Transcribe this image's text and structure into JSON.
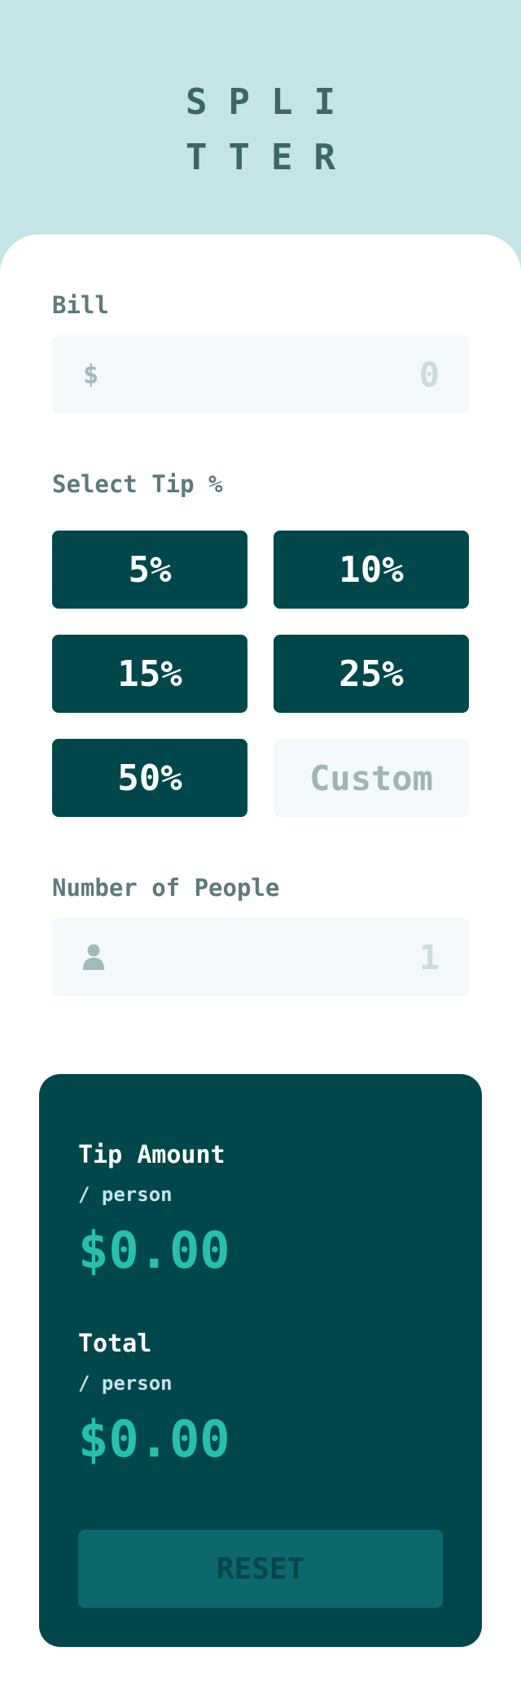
{
  "app": {
    "logo_line1": "SPLI",
    "logo_line2": "TTER"
  },
  "bill": {
    "label": "Bill",
    "currency_icon": "$",
    "placeholder": "0",
    "value": ""
  },
  "tip": {
    "label": "Select Tip %",
    "options": [
      "5%",
      "10%",
      "15%",
      "25%",
      "50%"
    ],
    "custom_placeholder": "Custom"
  },
  "people": {
    "label": "Number of People",
    "icon": "person-icon",
    "placeholder": "1",
    "value": ""
  },
  "results": {
    "tip_title": "Tip Amount",
    "tip_sub": "/ person",
    "tip_value": "$0.00",
    "total_title": "Total",
    "total_sub": "/ person",
    "total_value": "$0.00",
    "reset_label": "RESET"
  },
  "colors": {
    "background": "#c5e4e7",
    "dark_cyan": "#00474b",
    "accent": "#26c0ab",
    "input_bg": "#f3f9fa"
  }
}
